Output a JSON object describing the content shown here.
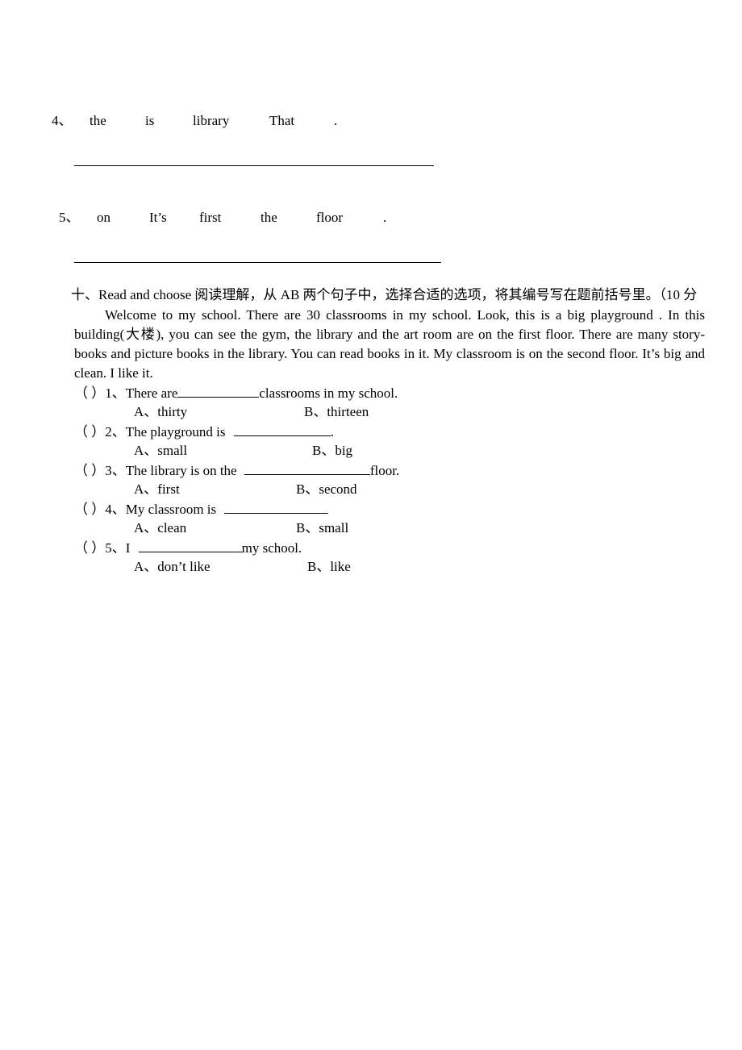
{
  "scramble_items": [
    {
      "number": "4、",
      "words": [
        "the",
        "is",
        "library",
        "That",
        "."
      ]
    },
    {
      "number": "5、",
      "words": [
        "on",
        "It’s",
        "first",
        "the",
        "floor",
        "."
      ]
    }
  ],
  "section": {
    "heading": "十、Read and choose 阅读理解，从 AB 两个句子中，选择合适的选项，将其编号写在题前括号里。（10 分",
    "passage": "Welcome to my school. There are 30 classrooms in my school. Look, this is a big playground . In this building(大楼), you can see the gym, the library and the art room are on the first floor. There are many story-books and picture books in the library. You can read books in it. My classroom is on the second floor. It’s big and clean. I like it.",
    "questions": [
      {
        "bracket": "（    ）",
        "number": "1、",
        "before": "There are",
        "after": "classrooms in my school.",
        "option_a": "A、thirty",
        "option_b": "B、thirteen"
      },
      {
        "bracket": "（    ）",
        "number": "2、",
        "before": "The playground is ",
        "after": ".",
        "option_a": "A、small",
        "option_b": "B、big"
      },
      {
        "bracket": "（    ）",
        "number": "3、",
        "before": "The library is on the ",
        "after": "floor.",
        "option_a": "A、first",
        "option_b": "B、second"
      },
      {
        "bracket": "（    ）",
        "number": "4、",
        "before": "My classroom is ",
        "after": "",
        "option_a": "A、clean",
        "option_b": "B、small"
      },
      {
        "bracket": "（    ）",
        "number": "5、",
        "before": "I ",
        "after": "my school.",
        "option_a": "A、don’t like",
        "option_b": "B、like"
      }
    ]
  }
}
